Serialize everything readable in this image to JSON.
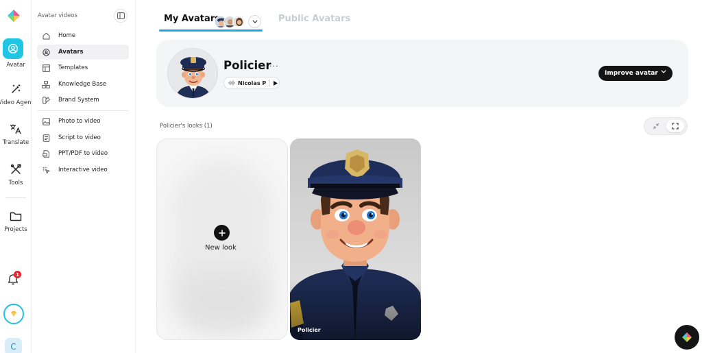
{
  "rail": {
    "items": [
      {
        "label": "Avatar",
        "icon": "avatar-icon"
      },
      {
        "label": "Video Agent",
        "icon": "magic-wand-icon"
      },
      {
        "label": "Translate",
        "icon": "translate-icon"
      },
      {
        "label": "Tools",
        "icon": "tools-icon"
      },
      {
        "label": "Projects",
        "icon": "folder-icon"
      }
    ],
    "notifications_count": "1",
    "user_initial": "C",
    "accent": "#20c6e6"
  },
  "subnav": {
    "title": "Avatar videos",
    "items": [
      {
        "label": "Home",
        "icon": "home-icon"
      },
      {
        "label": "Avatars",
        "icon": "avatar-icon"
      },
      {
        "label": "Templates",
        "icon": "templates-icon"
      },
      {
        "label": "Knowledge Base",
        "icon": "knowledge-base-icon"
      },
      {
        "label": "Brand System",
        "icon": "brand-system-icon"
      },
      {
        "label": "Photo to video",
        "icon": "photo-icon"
      },
      {
        "label": "Script to video",
        "icon": "script-icon"
      },
      {
        "label": "PPT/PDF to video",
        "icon": "presentation-icon"
      },
      {
        "label": "Interactive video",
        "icon": "interactive-icon"
      }
    ]
  },
  "tabs": {
    "my_avatars": "My Avatars",
    "public_avatars": "Public Avatars"
  },
  "profile": {
    "name": "Policier",
    "more": "···",
    "voice": "Nicolas P",
    "improve_label": "Improve avatar"
  },
  "looks": {
    "header": "Policier's looks (1)",
    "new_look_label": "New look",
    "items": [
      {
        "caption": "Policier"
      }
    ]
  }
}
